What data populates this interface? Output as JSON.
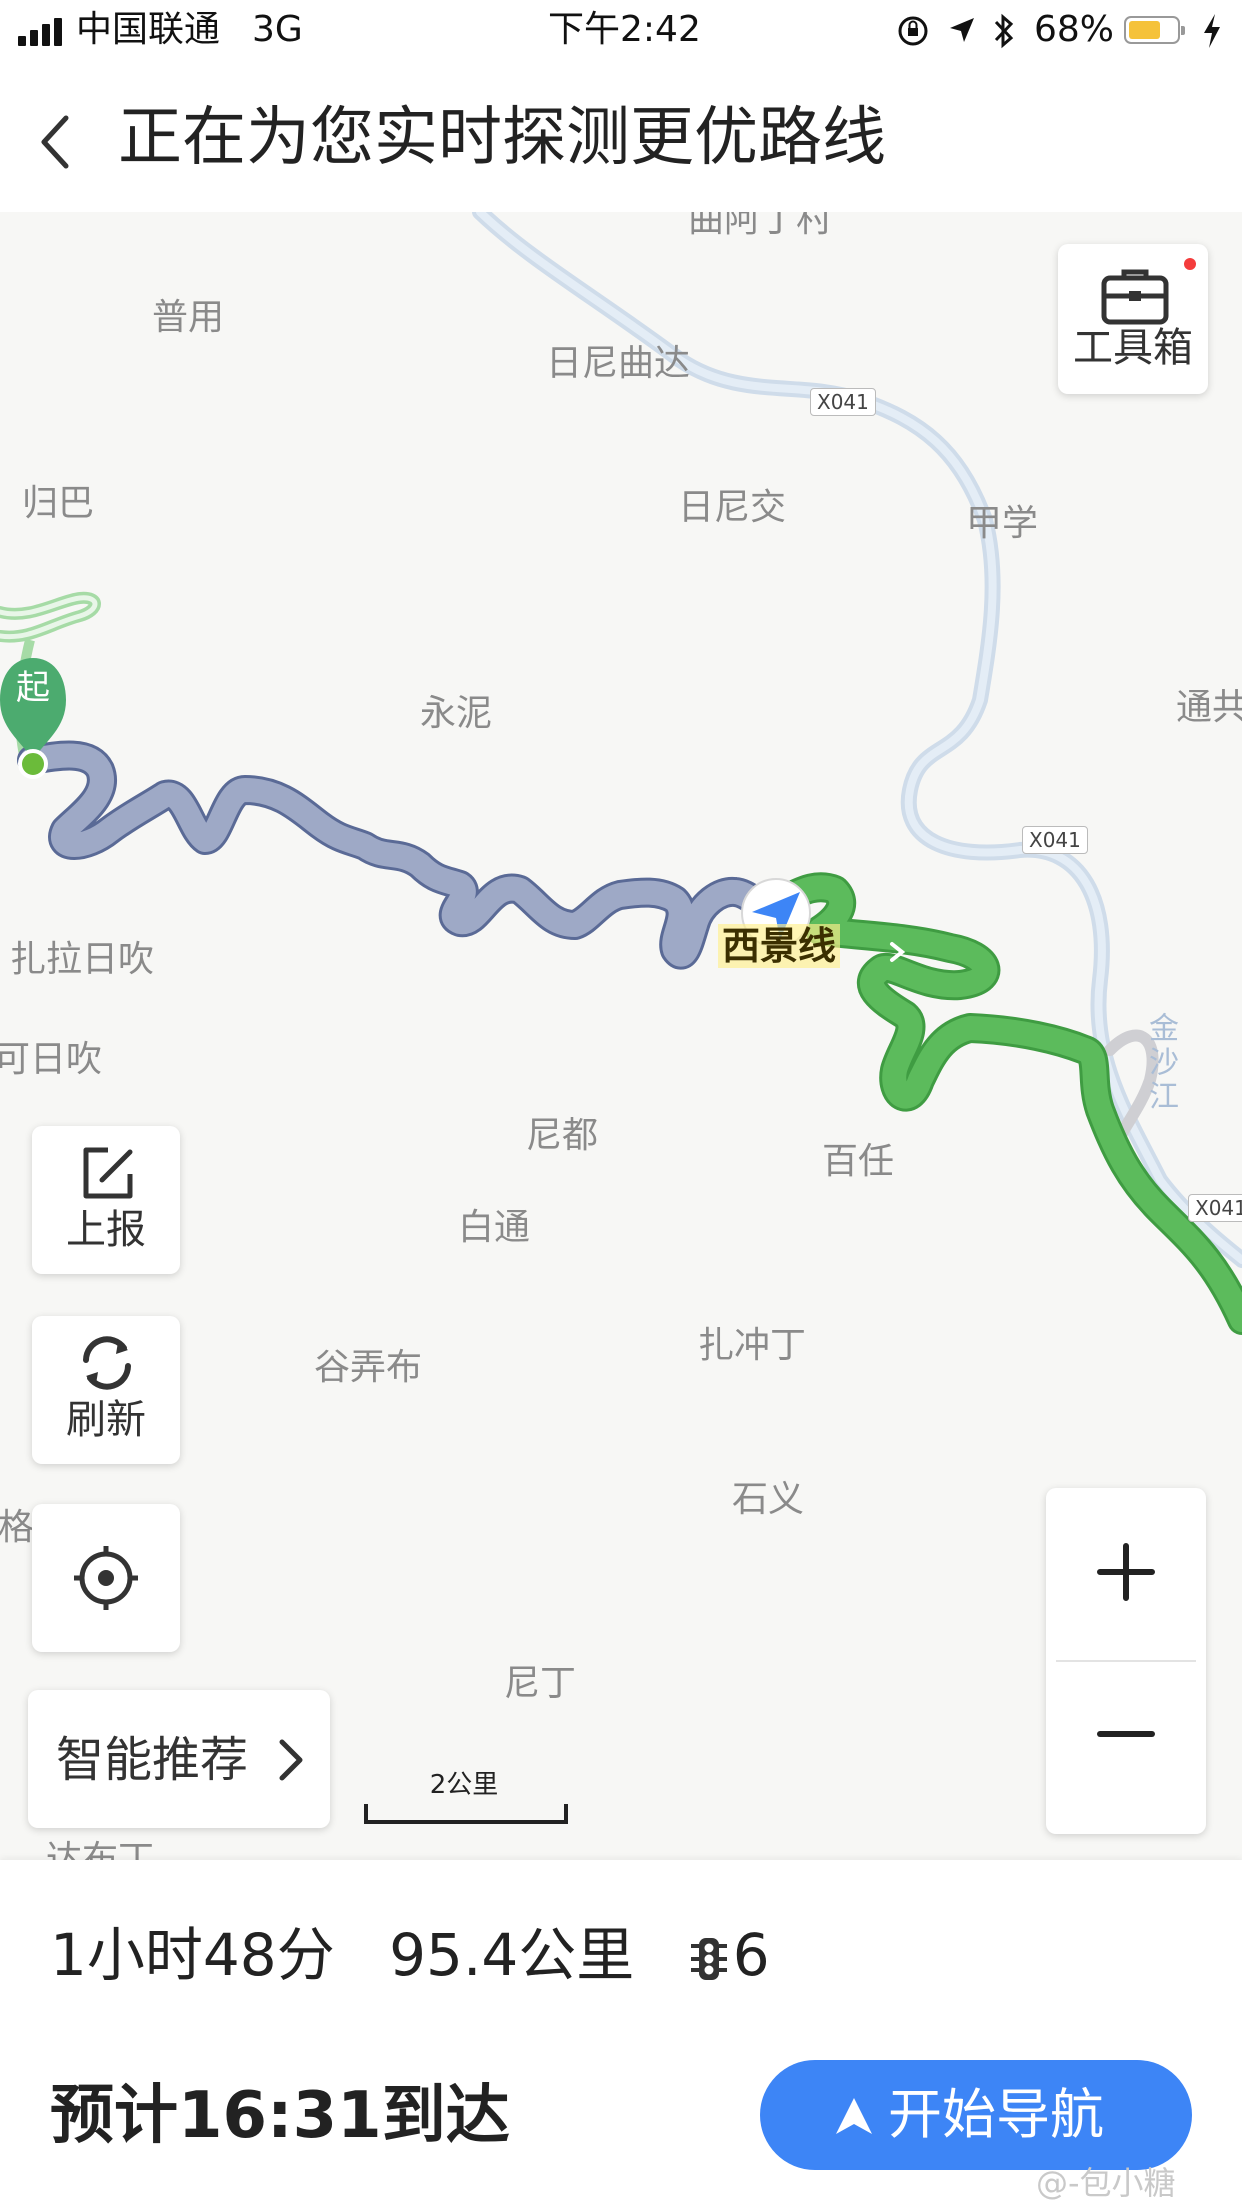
{
  "status_bar": {
    "carrier": "中国联通",
    "network": "3G",
    "time": "下午2:42",
    "battery": "68%",
    "battery_level": 0.68
  },
  "header": {
    "title": "正在为您实时探测更优路线"
  },
  "map": {
    "place_labels": [
      "曲阿丁村",
      "普用",
      "日尼曲达",
      "归巴",
      "日尼交",
      "甲学",
      "永泥",
      "通共",
      "扎拉日吹",
      "可日吹",
      "尼都",
      "百任",
      "白通",
      "谷弄布",
      "扎冲丁",
      "石义",
      "格",
      "尼丁",
      "达布丁"
    ],
    "road_tags": [
      "X041",
      "X041",
      "X041"
    ],
    "river_label": "金沙江",
    "route_road_label": "西景线",
    "start_marker": "起",
    "scale": "2公里",
    "colors": {
      "traveled": "#98a4c2",
      "clear": "#5cbb5c",
      "river": "#d6e5f2",
      "accent": "#3d85f6"
    }
  },
  "toolbox": {
    "label": "工具箱"
  },
  "side_buttons": {
    "report": "上报",
    "refresh": "刷新"
  },
  "smart_recommend": {
    "label": "智能推荐"
  },
  "route": {
    "duration": "1小时48分",
    "distance": "95.4公里",
    "traffic_lights": "6",
    "eta": "预计16:31到达",
    "start_button": "开始导航"
  },
  "watermark": "@-包小糖"
}
